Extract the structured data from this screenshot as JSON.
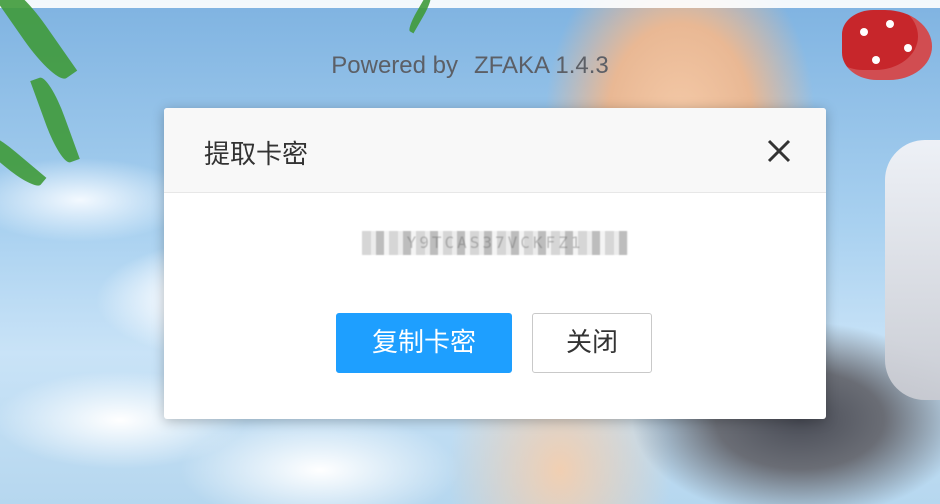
{
  "footer": {
    "powered_label": "Powered by",
    "app_version": "ZFAKA 1.4.3"
  },
  "dialog": {
    "title": "提取卡密",
    "secret_value": "Y9TCAS37VCKFZ1",
    "copy_button_label": "复制卡密",
    "close_button_label": "关闭"
  },
  "colors": {
    "primary_button": "#1e9fff",
    "dialog_header_bg": "#f8f8f8"
  },
  "icons": {
    "close": "close-icon"
  }
}
